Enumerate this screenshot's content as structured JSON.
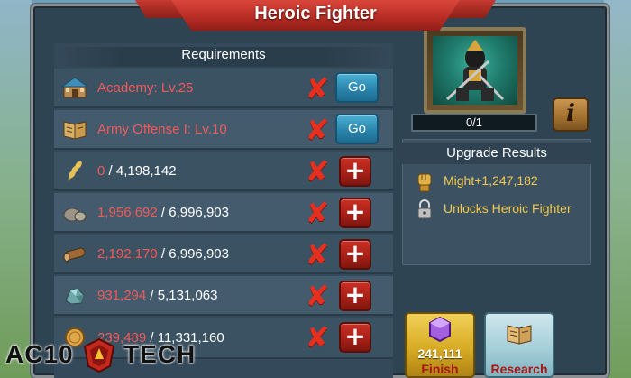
{
  "window": {
    "title": "Heroic Fighter"
  },
  "requirements": {
    "header": "Requirements",
    "rows": [
      {
        "icon": "academy-icon",
        "text": "Academy: Lv.25",
        "met": false,
        "action": "Go"
      },
      {
        "icon": "book-icon",
        "text": "Army Offense I: Lv.10",
        "met": false,
        "action": "Go"
      },
      {
        "icon": "wheat-icon",
        "have": "0",
        "need": " / 4,198,142",
        "met": false,
        "action": "+"
      },
      {
        "icon": "stone-icon",
        "have": "1,956,692",
        "need": " / 6,996,903",
        "met": false,
        "action": "+"
      },
      {
        "icon": "wood-icon",
        "have": "2,192,170",
        "need": " / 6,996,903",
        "met": false,
        "action": "+"
      },
      {
        "icon": "ore-icon",
        "have": "931,294",
        "need": " / 5,131,063",
        "met": false,
        "action": "+"
      },
      {
        "icon": "gold-icon",
        "have": "239,489",
        "need": " / 11,331,160",
        "met": false,
        "action": "+"
      }
    ]
  },
  "research": {
    "level_progress": "0/1",
    "info_label": "i"
  },
  "upgrade_results": {
    "header": "Upgrade Results",
    "might": "Might+1,247,182",
    "unlock": "Unlocks Heroic Fighter"
  },
  "actions": {
    "finish_count": "241,111",
    "finish_label": "Finish",
    "research_label": "Research"
  },
  "watermark": {
    "left": "AC10",
    "right": "TECH",
    "logo_text": "AC10 Tech"
  },
  "colors": {
    "unmet": "#f05a5a",
    "result": "#f2c94c",
    "banner": "#c53a31"
  }
}
